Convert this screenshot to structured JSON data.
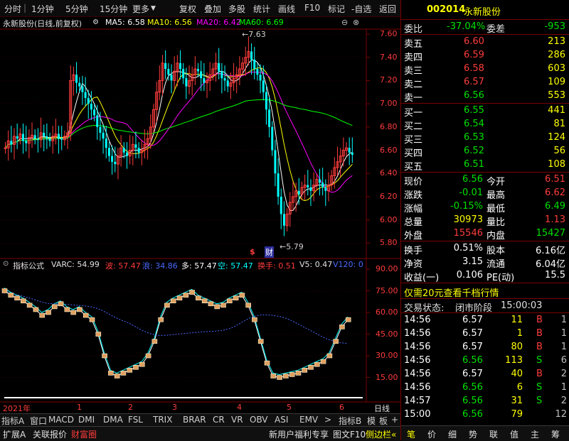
{
  "toolbar": {
    "items": [
      "分时",
      "1分钟",
      "5分钟",
      "15分钟",
      "更多",
      "复权",
      "叠加",
      "多股",
      "统计",
      "画线",
      "F10",
      "标记",
      "-自选",
      "返回"
    ]
  },
  "main_chart": {
    "stock_title": "永新股份(日线,前复权)",
    "ma5": "MA5: 6.58",
    "ma10": "MA10: 6.56",
    "ma20": "MA20: 6.42",
    "ma60": "MA60: 6.69",
    "price_axis": [
      "7.60",
      "7.40",
      "7.20",
      "7.00",
      "6.80",
      "6.60",
      "6.40",
      "6.20",
      "6.00",
      "5.80"
    ],
    "high_label": "7.63",
    "low_label": "5.79",
    "marker_1": "$",
    "marker_2": "财",
    "colors": {
      "ma5": "#ffffff",
      "ma10": "#ffff00",
      "ma20": "#ff00ff",
      "ma60": "#00ff00",
      "up": "#ff3c3c",
      "down": "#00ffff"
    }
  },
  "indicator": {
    "name": "指标公式",
    "varc": "VARC: 54.99",
    "bo": "波: 57.47",
    "lang": "浪: 34.86",
    "duo": "多: 57.47",
    "kong": "空: 57.47",
    "huanshou": "换手: 0.51",
    "v5": "V5: 0.47",
    "v120": "V120: 0",
    "axis": [
      "90.00",
      "75.00",
      "60.00",
      "45.00",
      "30.00",
      "15.00"
    ]
  },
  "time_axis": {
    "year": "2021年",
    "months": [
      "1",
      "2",
      "3",
      "4",
      "5",
      "6"
    ],
    "period": "日线"
  },
  "indicator_tabs": [
    "指标A",
    "窗口",
    "MACD",
    "DMI",
    "DMA",
    "FSL",
    "TRIX",
    "BRAR",
    "CR",
    "VR",
    "OBV",
    "ASI",
    "EMV",
    ">",
    "指标B",
    "模",
    "板",
    "+",
    "-"
  ],
  "bottom_tabs": [
    "扩展A",
    "关联报价",
    "财富圈"
  ],
  "bottom_right": [
    "新用户福利专享",
    "图文F10",
    "侧边栏"
  ],
  "quote": {
    "code": "002014",
    "name": "永新股份",
    "weibi_label": "委比",
    "weibi": "-37.04%",
    "weicha_label": "委差",
    "weicha": "-953",
    "sell": [
      {
        "label": "卖五",
        "price": "6.60",
        "vol": "213"
      },
      {
        "label": "卖四",
        "price": "6.59",
        "vol": "286"
      },
      {
        "label": "卖三",
        "price": "6.58",
        "vol": "603"
      },
      {
        "label": "卖二",
        "price": "6.57",
        "vol": "109"
      },
      {
        "label": "卖一",
        "price": "6.56",
        "vol": "553"
      }
    ],
    "buy": [
      {
        "label": "买一",
        "price": "6.55",
        "vol": "441"
      },
      {
        "label": "买二",
        "price": "6.54",
        "vol": "81"
      },
      {
        "label": "买三",
        "price": "6.53",
        "vol": "124"
      },
      {
        "label": "买四",
        "price": "6.52",
        "vol": "56"
      },
      {
        "label": "买五",
        "price": "6.51",
        "vol": "108"
      }
    ],
    "stats": [
      {
        "l1": "现价",
        "v1": "6.56",
        "l2": "今开",
        "v2": "6.51"
      },
      {
        "l1": "涨跌",
        "v1": "-0.01",
        "l2": "最高",
        "v2": "6.62"
      },
      {
        "l1": "涨幅",
        "v1": "-0.15%",
        "l2": "最低",
        "v2": "6.49"
      },
      {
        "l1": "总量",
        "v1": "30973",
        "l2": "量比",
        "v2": "1.13"
      },
      {
        "l1": "外盘",
        "v1": "15546",
        "l2": "内盘",
        "v2": "15427"
      }
    ],
    "stats2": [
      {
        "l1": "换手",
        "v1": "0.51%",
        "l2": "股本",
        "v2": "6.16亿"
      },
      {
        "l1": "净资",
        "v1": "3.15",
        "l2": "流通",
        "v2": "6.04亿"
      },
      {
        "l1": "收益(一)",
        "v1": "0.106",
        "l2": "PE(动)",
        "v2": "15.5"
      }
    ],
    "promo": "仅需20元查看千档行情",
    "status_label": "交易状态:",
    "status": "闭市阶段",
    "status_time": "15:00:03",
    "ticks": [
      {
        "t": "14:56",
        "p": "6.57",
        "v": "11",
        "d": "B",
        "n": "1"
      },
      {
        "t": "14:56",
        "p": "6.57",
        "v": "1",
        "d": "B",
        "n": "1"
      },
      {
        "t": "14:56",
        "p": "6.57",
        "v": "80",
        "d": "B",
        "n": "1"
      },
      {
        "t": "14:56",
        "p": "6.56",
        "v": "113",
        "d": "S",
        "n": "6"
      },
      {
        "t": "14:56",
        "p": "6.57",
        "v": "40",
        "d": "B",
        "n": "2"
      },
      {
        "t": "14:56",
        "p": "6.56",
        "v": "6",
        "d": "S",
        "n": "1"
      },
      {
        "t": "14:57",
        "p": "6.56",
        "v": "31",
        "d": "S",
        "n": "2"
      },
      {
        "t": "15:00",
        "p": "6.56",
        "v": "79",
        "d": "",
        "n": "12"
      }
    ],
    "side_tabs": [
      "笔",
      "价",
      "细",
      "势",
      "联",
      "值",
      "主",
      "筹"
    ]
  }
}
